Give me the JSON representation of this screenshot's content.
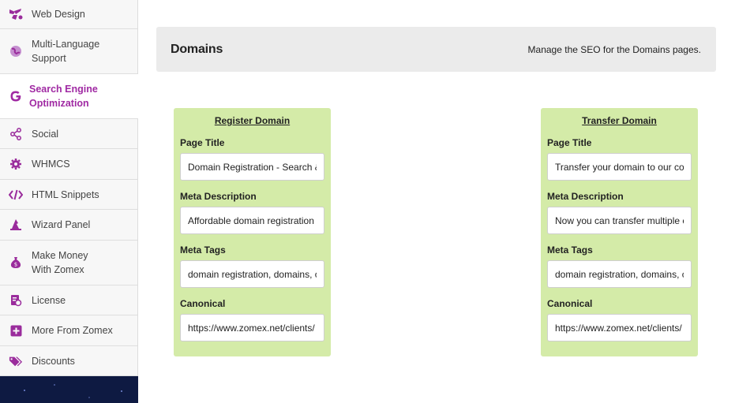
{
  "sidebar": {
    "items": [
      {
        "label": "Web Design",
        "icon": "paint-icon"
      },
      {
        "label": "Multi-Language Support",
        "icon": "globe-icon"
      },
      {
        "label": "Search Engine Optimization",
        "icon": "google-icon",
        "active": true
      },
      {
        "label": "Social",
        "icon": "share-icon"
      },
      {
        "label": "WHMCS",
        "icon": "gear-icon"
      },
      {
        "label": "HTML Snippets",
        "icon": "code-icon"
      },
      {
        "label": "Wizard Panel",
        "icon": "wizard-hat-icon"
      },
      {
        "label": "Make Money With Zomex",
        "icon": "money-bag-icon"
      },
      {
        "label": "License",
        "icon": "license-icon"
      },
      {
        "label": "More From Zomex",
        "icon": "plus-square-icon"
      },
      {
        "label": "Discounts",
        "icon": "tags-icon"
      }
    ]
  },
  "header": {
    "title": "Domains",
    "description": "Manage the SEO for the Domains pages."
  },
  "cards": [
    {
      "title": "Register Domain",
      "fields": {
        "page_title_label": "Page Title",
        "page_title_value": "Domain Registration - Search &",
        "meta_description_label": "Meta Description",
        "meta_description_value": "Affordable domain registration",
        "meta_tags_label": "Meta Tags",
        "meta_tags_value": "domain registration, domains, c",
        "canonical_label": "Canonical",
        "canonical_value": "https://www.zomex.net/clients/"
      }
    },
    {
      "title": "Transfer Domain",
      "fields": {
        "page_title_label": "Page Title",
        "page_title_value": "Transfer your domain to our co",
        "meta_description_label": "Meta Description",
        "meta_description_value": "Now you can transfer multiple c",
        "meta_tags_label": "Meta Tags",
        "meta_tags_value": "domain registration, domains, c",
        "canonical_label": "Canonical",
        "canonical_value": "https://www.zomex.net/clients/"
      }
    }
  ],
  "colors": {
    "accent": "#a02aa3",
    "card_bg": "#d4eba8",
    "header_bg": "#ebebeb",
    "sidebar_bg": "#f7f7f7",
    "footer_bg": "#0e1a42"
  }
}
